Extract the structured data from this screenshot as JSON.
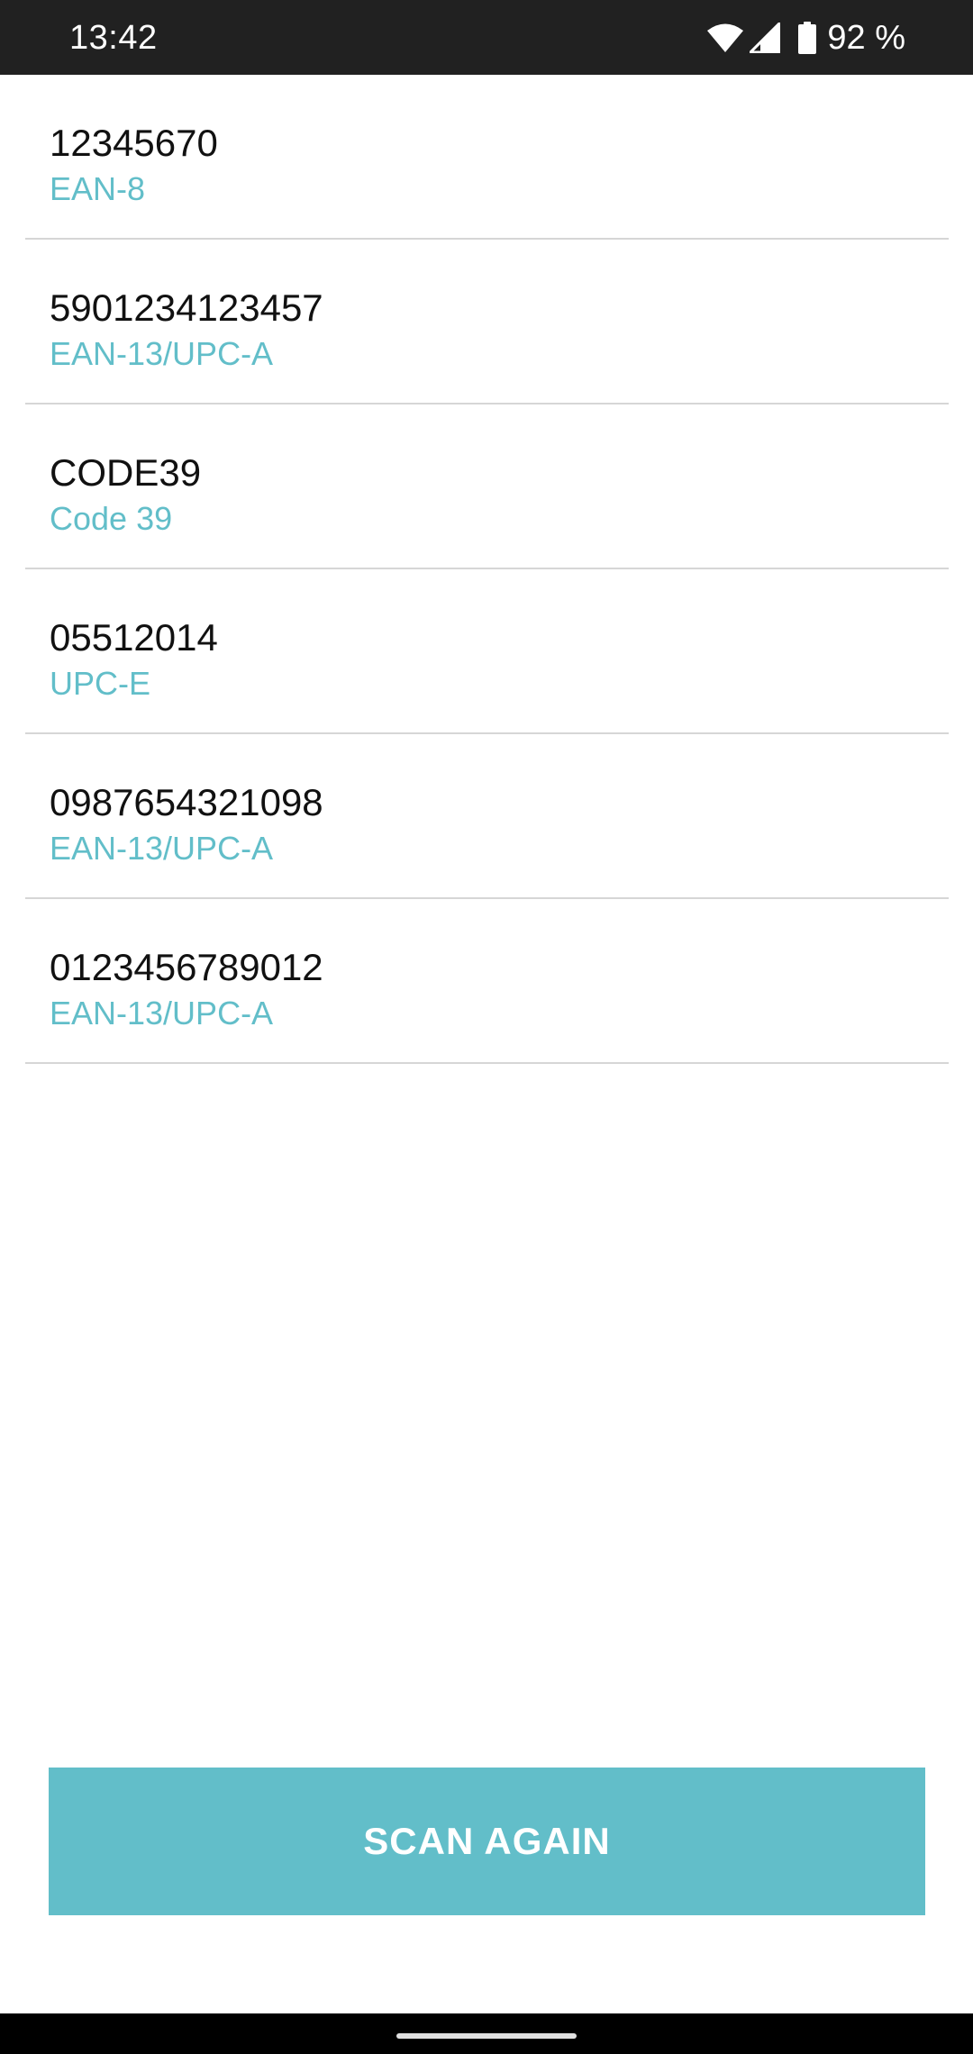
{
  "status_bar": {
    "time": "13:42",
    "battery_percent": "92 %",
    "icons": [
      "wifi-icon",
      "signal-icon",
      "battery-icon"
    ]
  },
  "colors": {
    "accent": "#62bec9",
    "status_bar_bg": "#212121",
    "nav_bar_bg": "#000000",
    "divider": "#d6d6d6"
  },
  "scans": [
    {
      "value": "12345670",
      "format": "EAN-8"
    },
    {
      "value": "5901234123457",
      "format": "EAN-13/UPC-A"
    },
    {
      "value": "CODE39",
      "format": "Code 39"
    },
    {
      "value": "05512014",
      "format": "UPC-E"
    },
    {
      "value": "0987654321098",
      "format": "EAN-13/UPC-A"
    },
    {
      "value": "0123456789012",
      "format": "EAN-13/UPC-A"
    }
  ],
  "actions": {
    "scan_again_label": "SCAN AGAIN"
  }
}
